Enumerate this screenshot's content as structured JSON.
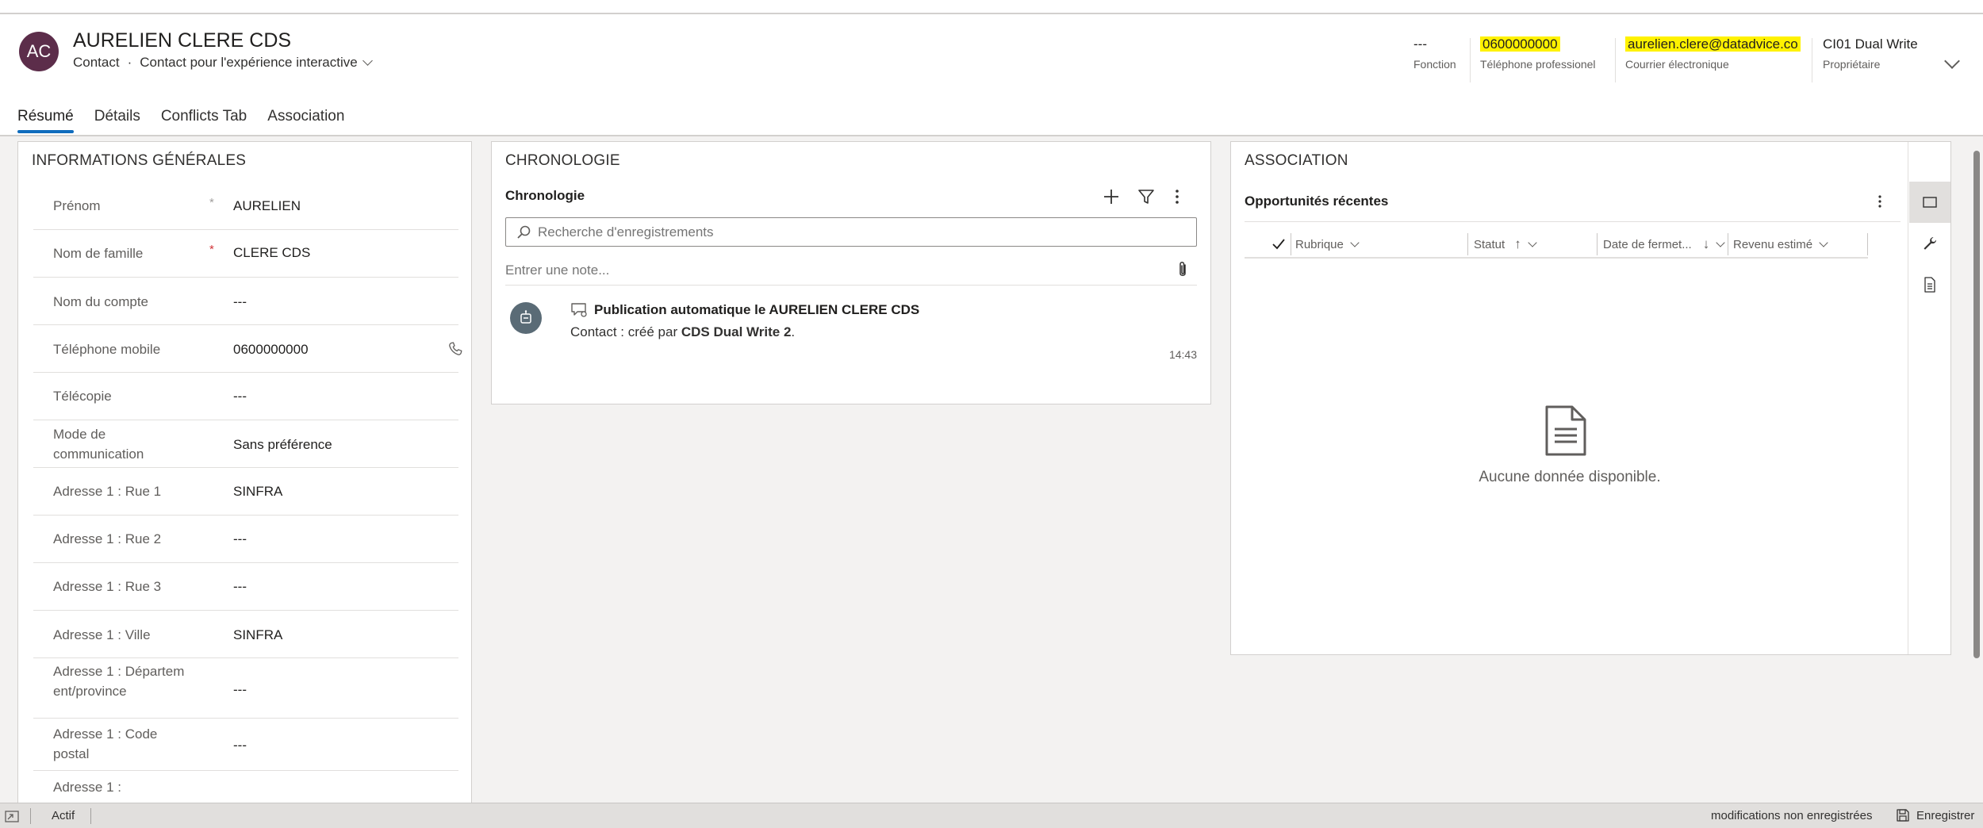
{
  "header": {
    "avatar_initials": "AC",
    "record_name": "AURELIEN CLERE CDS",
    "entity": "Contact",
    "entity_sep": "·",
    "form_name": "Contact pour l'expérience interactive",
    "fields": [
      {
        "value": "---",
        "label": "Fonction"
      },
      {
        "value": "0600000000",
        "label": "Téléphone professionel"
      },
      {
        "value": "aurelien.clere@datadvice.co",
        "label": "Courrier électronique"
      },
      {
        "value": "CI01 Dual Write",
        "label": "Propriétaire"
      }
    ],
    "highlight_color": "#fff200",
    "avatar_color": "#5c2d4a"
  },
  "tabs": [
    {
      "label": "Résumé",
      "active": true
    },
    {
      "label": "Détails"
    },
    {
      "label": "Conflicts Tab"
    },
    {
      "label": "Association"
    }
  ],
  "general": {
    "title": "INFORMATIONS GÉNÉRALES",
    "fields": [
      {
        "label": "Prénom",
        "required": "recommended",
        "value": "AURELIEN"
      },
      {
        "label": "Nom de famille",
        "required": "required",
        "value": "CLERE CDS"
      },
      {
        "label": "Nom du compte",
        "value": "---"
      },
      {
        "label": "Téléphone mobile",
        "value": "0600000000",
        "icon": "phone-icon"
      },
      {
        "label": "Télécopie",
        "value": "---"
      },
      {
        "label": "Mode de communication",
        "value": "Sans préférence"
      },
      {
        "label": "Adresse 1 : Rue 1",
        "value": "SINFRA"
      },
      {
        "label": "Adresse 1 : Rue 2",
        "value": "---"
      },
      {
        "label": "Adresse 1 : Rue 3",
        "value": "---"
      },
      {
        "label": "Adresse 1 : Ville",
        "value": "SINFRA"
      },
      {
        "label": "Adresse 1 : Département/province",
        "value": "---"
      },
      {
        "label": "Adresse 1 : Code postal",
        "value": "---"
      },
      {
        "label": "Adresse 1 :",
        "value": ""
      }
    ],
    "required_marker": "*"
  },
  "timeline": {
    "title": "CHRONOLOGIE",
    "subtitle": "Chronologie",
    "search_placeholder": "Recherche d'enregistrements",
    "note_placeholder": "Entrer une note...",
    "items": [
      {
        "title": "Publication automatique le AURELIEN CLERE CDS",
        "detail_prefix": "Contact : créé par ",
        "detail_author": "CDS Dual Write 2",
        "detail_suffix": ".",
        "time": "14:43"
      }
    ]
  },
  "association": {
    "title": "ASSOCIATION",
    "subtitle": "Opportunités récentes",
    "columns": [
      {
        "label": "Rubrique",
        "sort": ""
      },
      {
        "label": "Statut",
        "sort": "↑"
      },
      {
        "label": "Date de fermet...",
        "sort": "↓"
      },
      {
        "label": "Revenu estimé",
        "sort": ""
      }
    ],
    "empty_text": "Aucune donnée disponible."
  },
  "statusbar": {
    "status": "Actif",
    "unsaved": "modifications non enregistrées",
    "save": "Enregistrer"
  }
}
